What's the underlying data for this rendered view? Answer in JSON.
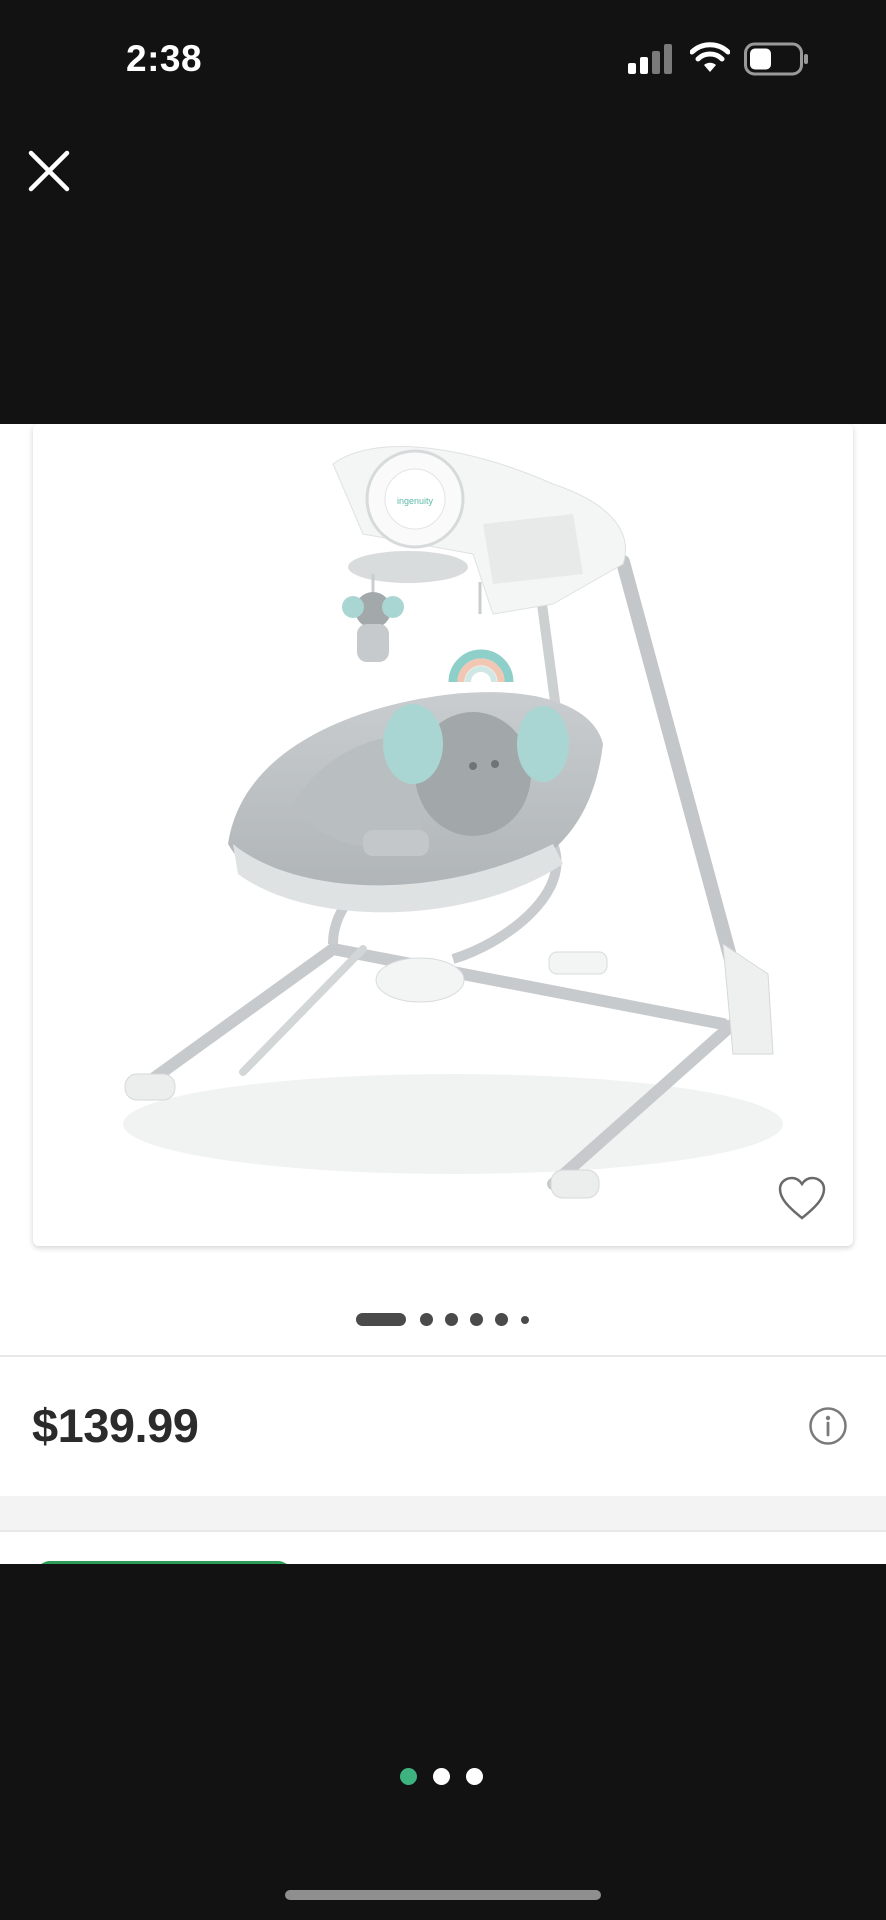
{
  "status_bar": {
    "time": "2:38",
    "signal_icon": "cellular-signal-icon",
    "wifi_icon": "wifi-icon",
    "battery_icon": "battery-icon"
  },
  "header": {
    "close_icon": "close-icon"
  },
  "product": {
    "image_alt": "Baby swing with elephant toy and rainbow mobile",
    "favorite_icon": "heart-outline-icon",
    "image_pager": {
      "total": 6,
      "active_index": 0
    },
    "price": "$139.99",
    "info_icon": "info-icon"
  },
  "bottom_carousel": {
    "total": 3,
    "active_index": 0,
    "active_color": "#3fb37f",
    "inactive_color": "#ffffff"
  },
  "colors": {
    "accent_green": "#2e9b57",
    "background": "#121212"
  }
}
